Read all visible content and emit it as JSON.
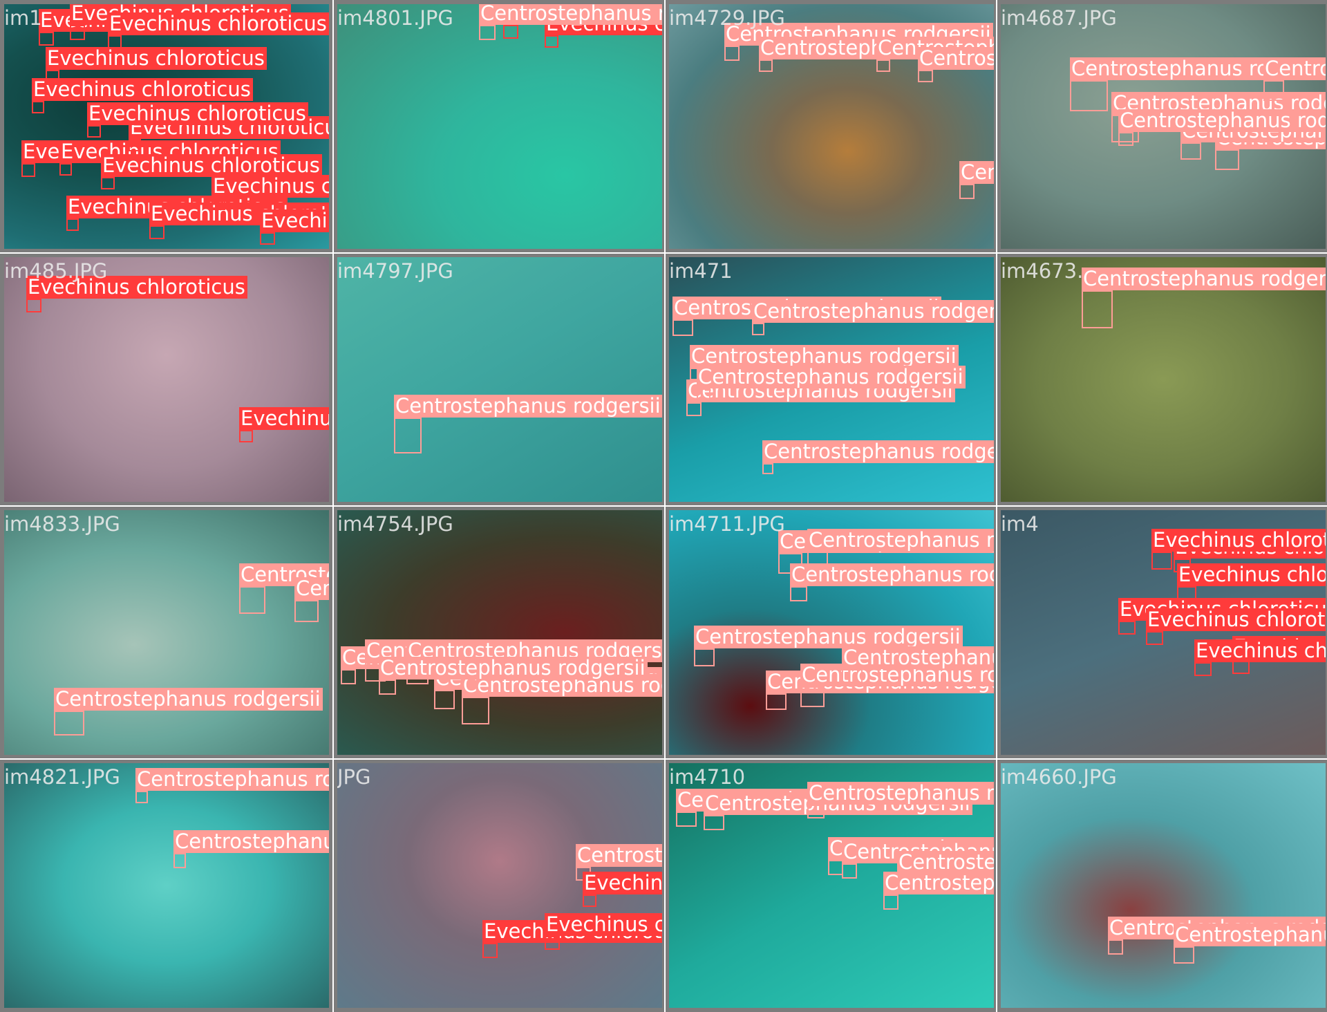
{
  "mosaic": {
    "columns": 4,
    "rows": 4,
    "colors": {
      "evechinus_label": "#ff3b3b",
      "centrostephanus_label": "#ff9d97",
      "filename_text": "#ebebeb",
      "tile_border": "#7c7c7c"
    },
    "tiles": [
      {
        "filename": "im1",
        "water_color": "#1f6e73",
        "detections": [
          {
            "label": "Evechinus chloroticus",
            "cls": "ec"
          },
          {
            "label": "Evechinus chloroticus",
            "cls": "ec"
          },
          {
            "label": "Evechinus chloroticus",
            "cls": "ec"
          },
          {
            "label": "Evechinus chloroticus",
            "cls": "ec"
          },
          {
            "label": "Evechinus chloroticus",
            "cls": "ec"
          },
          {
            "label": "Evechinus chloroticus",
            "cls": "ec"
          },
          {
            "label": "Evechinus chloroticus",
            "cls": "ec"
          },
          {
            "label": "Evechinus chloroticus",
            "cls": "ec"
          },
          {
            "label": "Evechinus chloroticus",
            "cls": "ec"
          },
          {
            "label": "Evechinus chloroticus",
            "cls": "ec"
          },
          {
            "label": "Evechinus chloroticus",
            "cls": "ec"
          },
          {
            "label": "Evechinus chloroticus",
            "cls": "ec"
          },
          {
            "label": "Evechinus chloroticus",
            "cls": "ec"
          },
          {
            "label": "Evechinus chloroticus",
            "cls": "ec"
          }
        ]
      },
      {
        "filename": "im4801.JPG",
        "water_color": "#2fb59d",
        "detections": [
          {
            "label": "Evechinus chloroticus",
            "cls": "ec"
          },
          {
            "label": "Evechinus chloroticus",
            "cls": "ec"
          },
          {
            "label": "Centrostephanus rodgersii",
            "cls": "cr"
          }
        ]
      },
      {
        "filename": "im4729.JPG",
        "water_color": "#5c8c8c",
        "detections": [
          {
            "label": "Centrostephanus rodgersii",
            "cls": "cr"
          },
          {
            "label": "Centrostephanus rodgersii",
            "cls": "cr"
          },
          {
            "label": "Centrostephanus rodgersii",
            "cls": "cr"
          },
          {
            "label": "Centrostephanus rodgersii",
            "cls": "cr"
          },
          {
            "label": "Centrostephanus rodgersii",
            "cls": "cr"
          }
        ]
      },
      {
        "filename": "im4687.JPG",
        "water_color": "#6f8c84",
        "detections": [
          {
            "label": "Centrostephanus rodgersii",
            "cls": "cr"
          },
          {
            "label": "Centrostephanus rodgersii",
            "cls": "cr"
          },
          {
            "label": "Centrostephanus rodgersii",
            "cls": "cr"
          },
          {
            "label": "Centrostephanus rodgersii",
            "cls": "cr"
          },
          {
            "label": "Centrostephanus rodgersii",
            "cls": "cr"
          },
          {
            "label": "Centrostephanus rodgersii",
            "cls": "cr"
          }
        ]
      },
      {
        "filename": "im485.JPG",
        "water_color": "#a58a99",
        "detections": [
          {
            "label": "Evechinus chloroticus",
            "cls": "ec"
          },
          {
            "label": "Evechinus chloroticus",
            "cls": "ec"
          }
        ]
      },
      {
        "filename": "im4797.JPG",
        "water_color": "#3fa6a0",
        "detections": [
          {
            "label": "Centrostephanus rodgersii",
            "cls": "cr"
          }
        ]
      },
      {
        "filename": "im471",
        "water_color": "#1a9ea8",
        "detections": [
          {
            "label": "Centrostephanus rodgersii",
            "cls": "cr"
          },
          {
            "label": "Centrostephanus rodgersii",
            "cls": "cr"
          },
          {
            "label": "Centrostephanus rodgersii",
            "cls": "cr"
          },
          {
            "label": "Centrostephanus rodgersii",
            "cls": "cr"
          },
          {
            "label": "Centrostephanus rodgersii",
            "cls": "cr"
          },
          {
            "label": "Centrostephanus rodgersii",
            "cls": "cr"
          }
        ]
      },
      {
        "filename": "im4673.",
        "water_color": "#6f7f46",
        "detections": [
          {
            "label": "Centrostephanus rodgersii",
            "cls": "cr"
          }
        ]
      },
      {
        "filename": "im4833.JPG",
        "water_color": "#6aa89d",
        "detections": [
          {
            "label": "Centrostephanus rodgersii",
            "cls": "cr"
          },
          {
            "label": "Centrostephanus rodgersii",
            "cls": "cr"
          },
          {
            "label": "Centrostephanus rodgersii",
            "cls": "cr"
          }
        ]
      },
      {
        "filename": "im4754.JPG",
        "water_color": "#3d3c2a",
        "detections": [
          {
            "label": "Centrostephanus rodgersii",
            "cls": "cr"
          },
          {
            "label": "Centrostephanus rodgersii",
            "cls": "cr"
          },
          {
            "label": "Centrostephanus rodgersii",
            "cls": "cr"
          },
          {
            "label": "Centrostephanus rodgersii",
            "cls": "cr"
          },
          {
            "label": "Centrostephanus rodgersii",
            "cls": "cr"
          },
          {
            "label": "Centrostephanus rodgersii",
            "cls": "cr"
          }
        ]
      },
      {
        "filename": "im4711.JPG",
        "water_color": "#20a6b6",
        "detections": [
          {
            "label": "Centrostephanus rodgersii",
            "cls": "cr"
          },
          {
            "label": "Centrostephanus rodgersii",
            "cls": "cr"
          },
          {
            "label": "Centrostephanus rodgersii",
            "cls": "cr"
          },
          {
            "label": "Centrostephanus rodgersii",
            "cls": "cr"
          },
          {
            "label": "Centrostephanus rodgersii",
            "cls": "cr"
          },
          {
            "label": "Centrostephanus rodgersii",
            "cls": "cr"
          },
          {
            "label": "Centrostephanus rodgersii",
            "cls": "cr"
          }
        ]
      },
      {
        "filename": "im4",
        "water_color": "#4c6f7d",
        "detections": [
          {
            "label": "Evechinus chloroticus",
            "cls": "ec"
          },
          {
            "label": "Evechinus chloroticus",
            "cls": "ec"
          },
          {
            "label": "Evechinus chloroticus",
            "cls": "ec"
          },
          {
            "label": "Evechinus chloroticus",
            "cls": "ec"
          },
          {
            "label": "Evechinus chloroticus",
            "cls": "ec"
          },
          {
            "label": "Evechinus chloroticus",
            "cls": "ec"
          },
          {
            "label": "Evechinus chloroticus",
            "cls": "ec"
          }
        ]
      },
      {
        "filename": "im4821.JPG",
        "water_color": "#3ab5b0",
        "detections": [
          {
            "label": "Centrostephanus rodgersii",
            "cls": "cr"
          },
          {
            "label": "Centrostephanus rodgersii",
            "cls": "cr"
          }
        ]
      },
      {
        "filename": "JPG",
        "water_color": "#5e7a8a",
        "detections": [
          {
            "label": "Centrostephanus rodgersii",
            "cls": "cr"
          },
          {
            "label": "Evechinus chloroticus",
            "cls": "ec"
          },
          {
            "label": "Evechinus chloroticus",
            "cls": "ec"
          },
          {
            "label": "Evechinus chloroticus",
            "cls": "ec"
          }
        ]
      },
      {
        "filename": "im4710",
        "water_color": "#1faa9c",
        "detections": [
          {
            "label": "Centrostephanus rodgersii",
            "cls": "cr"
          },
          {
            "label": "Centrostephanus rodgersii",
            "cls": "cr"
          },
          {
            "label": "Centrostephanus rodgersii",
            "cls": "cr"
          },
          {
            "label": "Centrostephanus rodgersii",
            "cls": "cr"
          },
          {
            "label": "Centrostephanus rodgersii",
            "cls": "cr"
          },
          {
            "label": "Centrostephanus rodgersii",
            "cls": "cr"
          },
          {
            "label": "Centrostephanus rodgersii",
            "cls": "cr"
          }
        ]
      },
      {
        "filename": "im4660.JPG",
        "water_color": "#4fa0a6",
        "detections": [
          {
            "label": "Centrostephanus rodgersii",
            "cls": "cr"
          },
          {
            "label": "Centrostephanus rodgersii",
            "cls": "cr"
          }
        ]
      }
    ]
  }
}
